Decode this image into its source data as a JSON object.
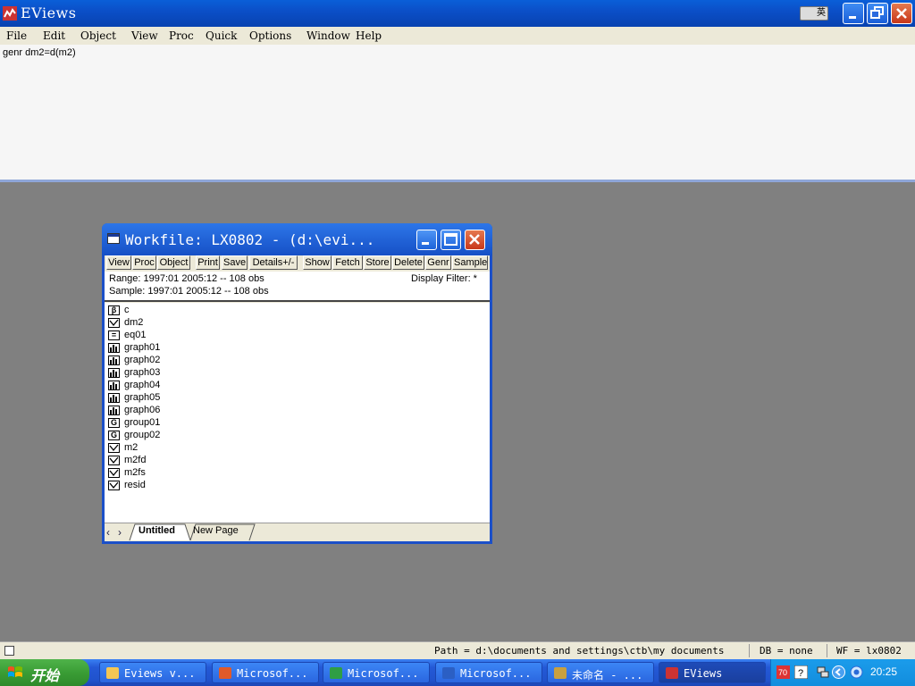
{
  "app": {
    "title": "EViews",
    "ime_label": "英"
  },
  "menu": [
    "File",
    "Edit",
    "Object",
    "View",
    "Proc",
    "Quick",
    "Options",
    "Window",
    "Help"
  ],
  "command": {
    "text": "genr dm2=d(m2)"
  },
  "workfile": {
    "title": "Workfile: LX0802 - (d:\\evi...",
    "toolbar": [
      "View",
      "Proc",
      "Object",
      "Print",
      "Save",
      "Details+/-",
      "Show",
      "Fetch",
      "Store",
      "Delete",
      "Genr",
      "Sample"
    ],
    "range": "Range:  1997:01 2005:12  --  108 obs",
    "sample": "Sample: 1997:01 2005:12  --  108 obs",
    "filter": "Display Filter: *",
    "objects": [
      {
        "name": "c",
        "type": "coef",
        "glyph": "β"
      },
      {
        "name": "dm2",
        "type": "series",
        "glyph": ""
      },
      {
        "name": "eq01",
        "type": "equation",
        "glyph": "="
      },
      {
        "name": "graph01",
        "type": "graph",
        "glyph": ""
      },
      {
        "name": "graph02",
        "type": "graph",
        "glyph": ""
      },
      {
        "name": "graph03",
        "type": "graph",
        "glyph": ""
      },
      {
        "name": "graph04",
        "type": "graph",
        "glyph": ""
      },
      {
        "name": "graph05",
        "type": "graph",
        "glyph": ""
      },
      {
        "name": "graph06",
        "type": "graph",
        "glyph": ""
      },
      {
        "name": "group01",
        "type": "group",
        "glyph": "G"
      },
      {
        "name": "group02",
        "type": "group",
        "glyph": "G"
      },
      {
        "name": "m2",
        "type": "series",
        "glyph": ""
      },
      {
        "name": "m2fd",
        "type": "series",
        "glyph": ""
      },
      {
        "name": "m2fs",
        "type": "series",
        "glyph": ""
      },
      {
        "name": "resid",
        "type": "series",
        "glyph": ""
      }
    ],
    "tabs": [
      "Untitled",
      "New Page"
    ]
  },
  "status": {
    "path": "Path = d:\\documents and settings\\ctb\\my documents",
    "db": "DB = none",
    "wf": "WF = lx0802"
  },
  "taskbar": {
    "start_label": "开始",
    "tasks": [
      "Eviews v...",
      "Microsof...",
      "Microsof...",
      "Microsof...",
      "未命名 - ...",
      "EViews"
    ],
    "task_icons": [
      "folder-icon",
      "outlook-icon",
      "excel-icon",
      "word-icon",
      "paint-icon",
      "eviews-icon"
    ],
    "clock": "20:25"
  }
}
